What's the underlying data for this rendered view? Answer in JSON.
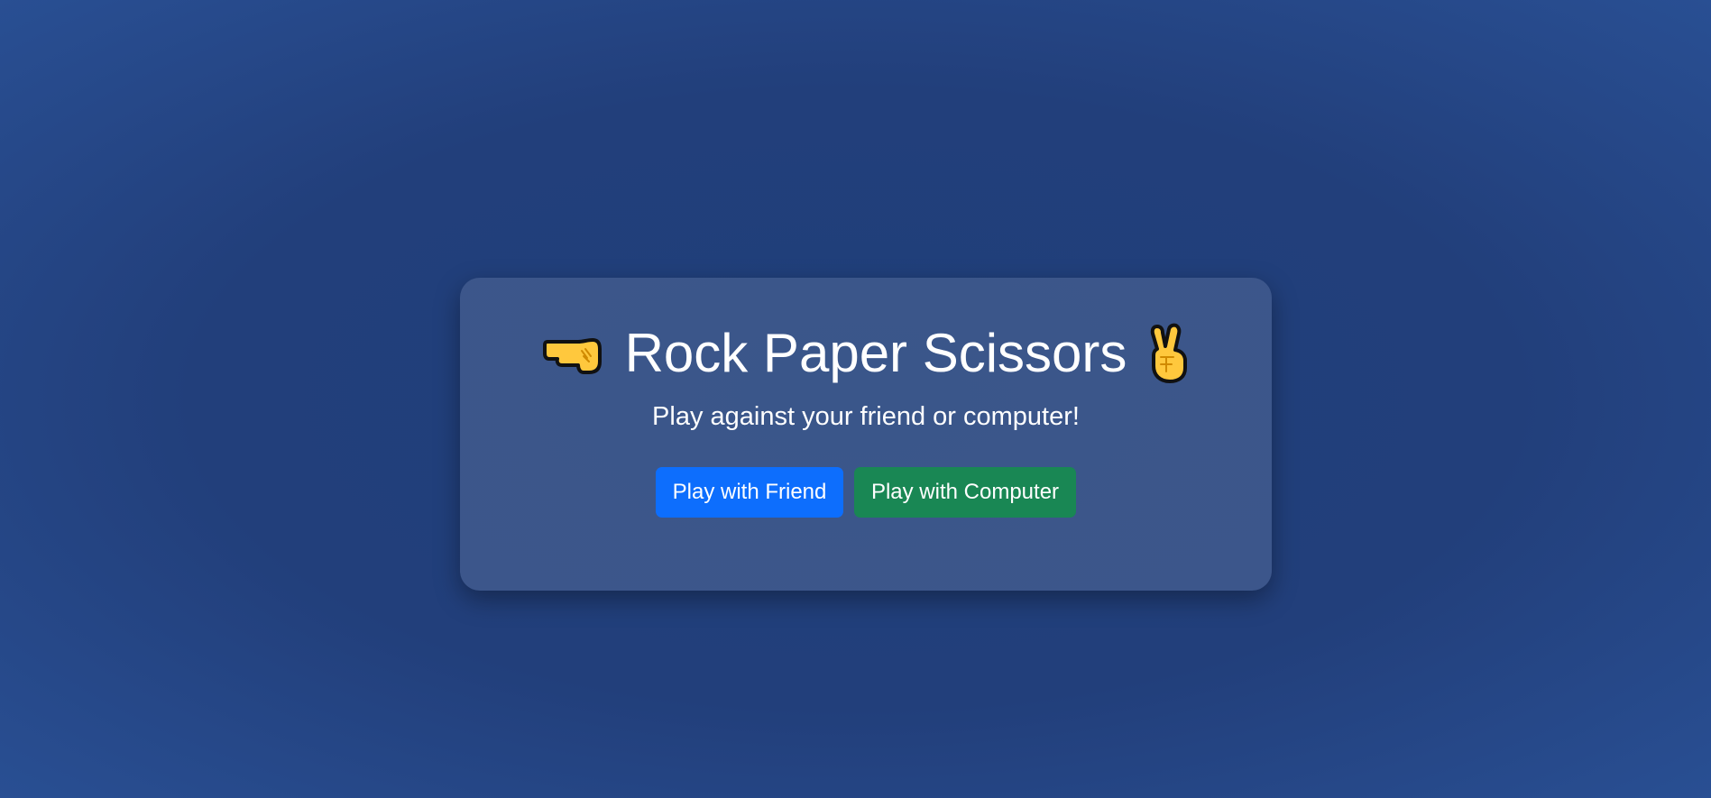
{
  "header": {
    "title": "Rock Paper Scissors",
    "left_icon": "left-facing-fist-icon",
    "right_icon": "victory-hand-icon"
  },
  "subtitle": "Play against your friend or computer!",
  "buttons": {
    "friend_label": "Play with Friend",
    "computer_label": "Play with Computer"
  },
  "colors": {
    "background": "#223f7b",
    "friend_button": "#0d6efd",
    "computer_button": "#198754",
    "text": "#ffffff",
    "emoji_yellow": "#ffc83d"
  }
}
